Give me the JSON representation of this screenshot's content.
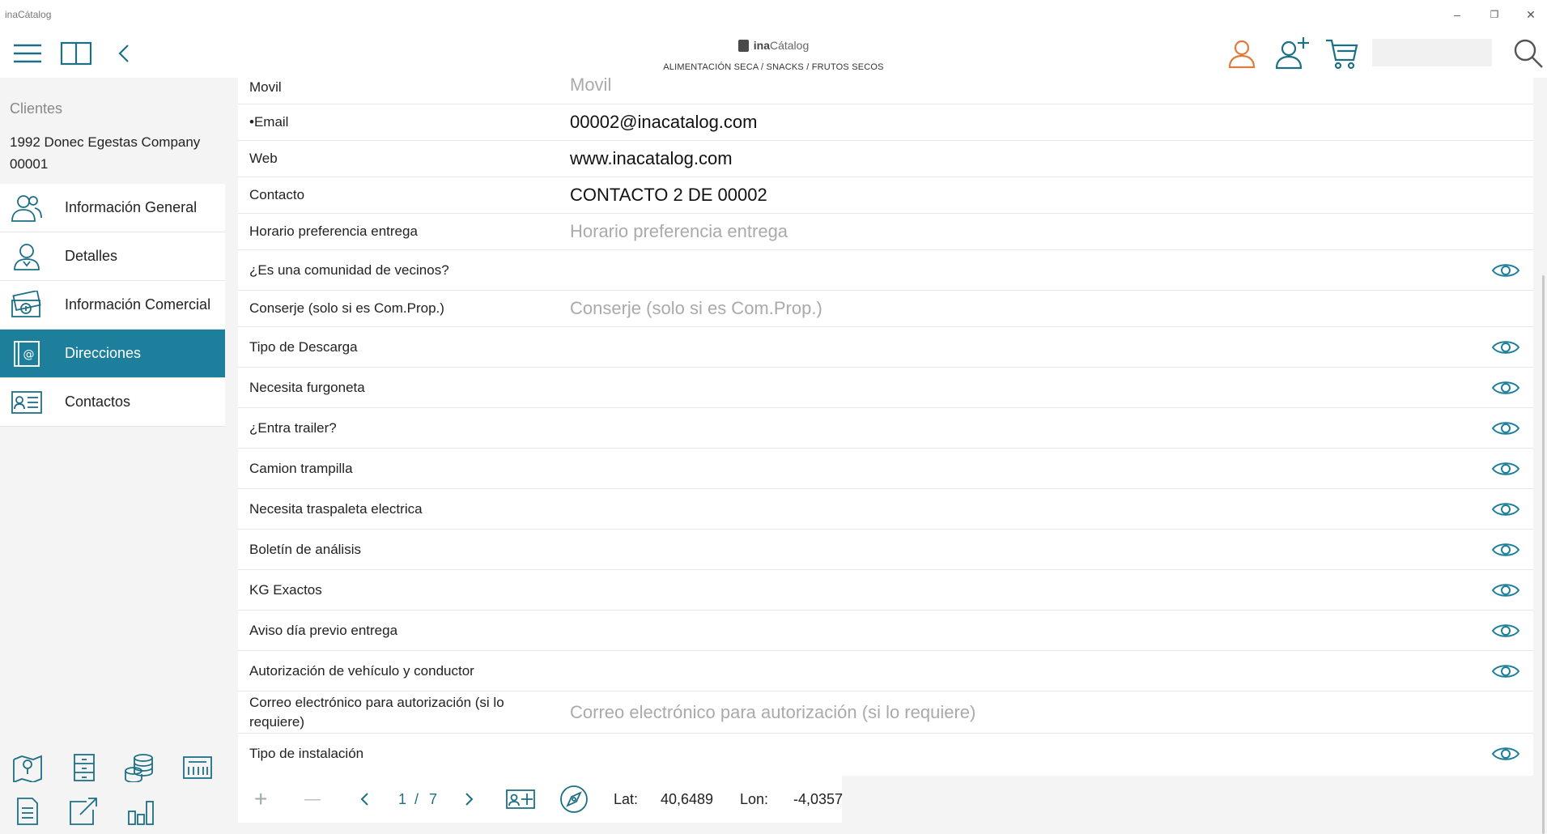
{
  "window": {
    "app_name": "inaCátalog",
    "minimize": "–",
    "restore": "❐",
    "close": "✕"
  },
  "header": {
    "brand_prefix": "ina",
    "brand_suffix": "Cátalog",
    "breadcrumb": "ALIMENTACIÓN SECA / SNACKS / FRUTOS SECOS"
  },
  "icons": {
    "menu": "menu-icon",
    "catalog": "book-icon",
    "back": "chevron-left-icon",
    "user": "user-icon",
    "add_user": "add-user-icon",
    "cart": "cart-icon",
    "search": "search-icon"
  },
  "colors": {
    "accent": "#1d7f9c",
    "user_icon": "#e07b3a",
    "icon_teal": "#1d6f86"
  },
  "sidebar": {
    "section": "Clientes",
    "client_line1": "1992 Donec Egestas Company",
    "client_line2": "00001",
    "items": [
      {
        "label": "Información General",
        "icon": "users-icon"
      },
      {
        "label": "Detalles",
        "icon": "user-detail-icon"
      },
      {
        "label": "Información Comercial",
        "icon": "money-icon"
      },
      {
        "label": "Direcciones",
        "icon": "address-icon",
        "active": true
      },
      {
        "label": "Contactos",
        "icon": "contact-card-icon"
      }
    ]
  },
  "form": {
    "rows": [
      {
        "label": "Movil",
        "value": "Movil",
        "placeholder": true
      },
      {
        "label": "•Email",
        "value": "00002@inacatalog.com"
      },
      {
        "label": "Web",
        "value": "www.inacatalog.com"
      },
      {
        "label": "Contacto",
        "value": "CONTACTO 2 DE 00002"
      },
      {
        "label": "Horario preferencia entrega",
        "value": "Horario preferencia entrega",
        "placeholder": true
      },
      {
        "label": "¿Es una comunidad de vecinos?",
        "eye": true
      },
      {
        "label": "Conserje (solo si es Com.Prop.)",
        "value": "Conserje (solo si es Com.Prop.)",
        "placeholder": true
      },
      {
        "label": "Tipo de Descarga",
        "eye": true
      },
      {
        "label": "Necesita furgoneta",
        "eye": true
      },
      {
        "label": "¿Entra trailer?",
        "eye": true
      },
      {
        "label": "Camion trampilla",
        "eye": true
      },
      {
        "label": "Necesita traspaleta electrica",
        "eye": true
      },
      {
        "label": "Boletín de análisis",
        "eye": true
      },
      {
        "label": "KG Exactos",
        "eye": true
      },
      {
        "label": "Aviso día previo entrega",
        "eye": true
      },
      {
        "label": "Autorización de vehículo y conductor",
        "eye": true
      },
      {
        "label": "Correo electrónico para autorización (si lo requiere)",
        "value": "Correo electrónico para autorización (si lo requiere)",
        "placeholder": true
      },
      {
        "label": "Tipo de instalación",
        "eye": true
      }
    ]
  },
  "pager": {
    "add": "+",
    "remove": "—",
    "page": "1",
    "sep": "/",
    "total": "7",
    "lat_label": "Lat:",
    "lat_value": "40,6489",
    "lon_label": "Lon:",
    "lon_value": "-4,0357"
  }
}
